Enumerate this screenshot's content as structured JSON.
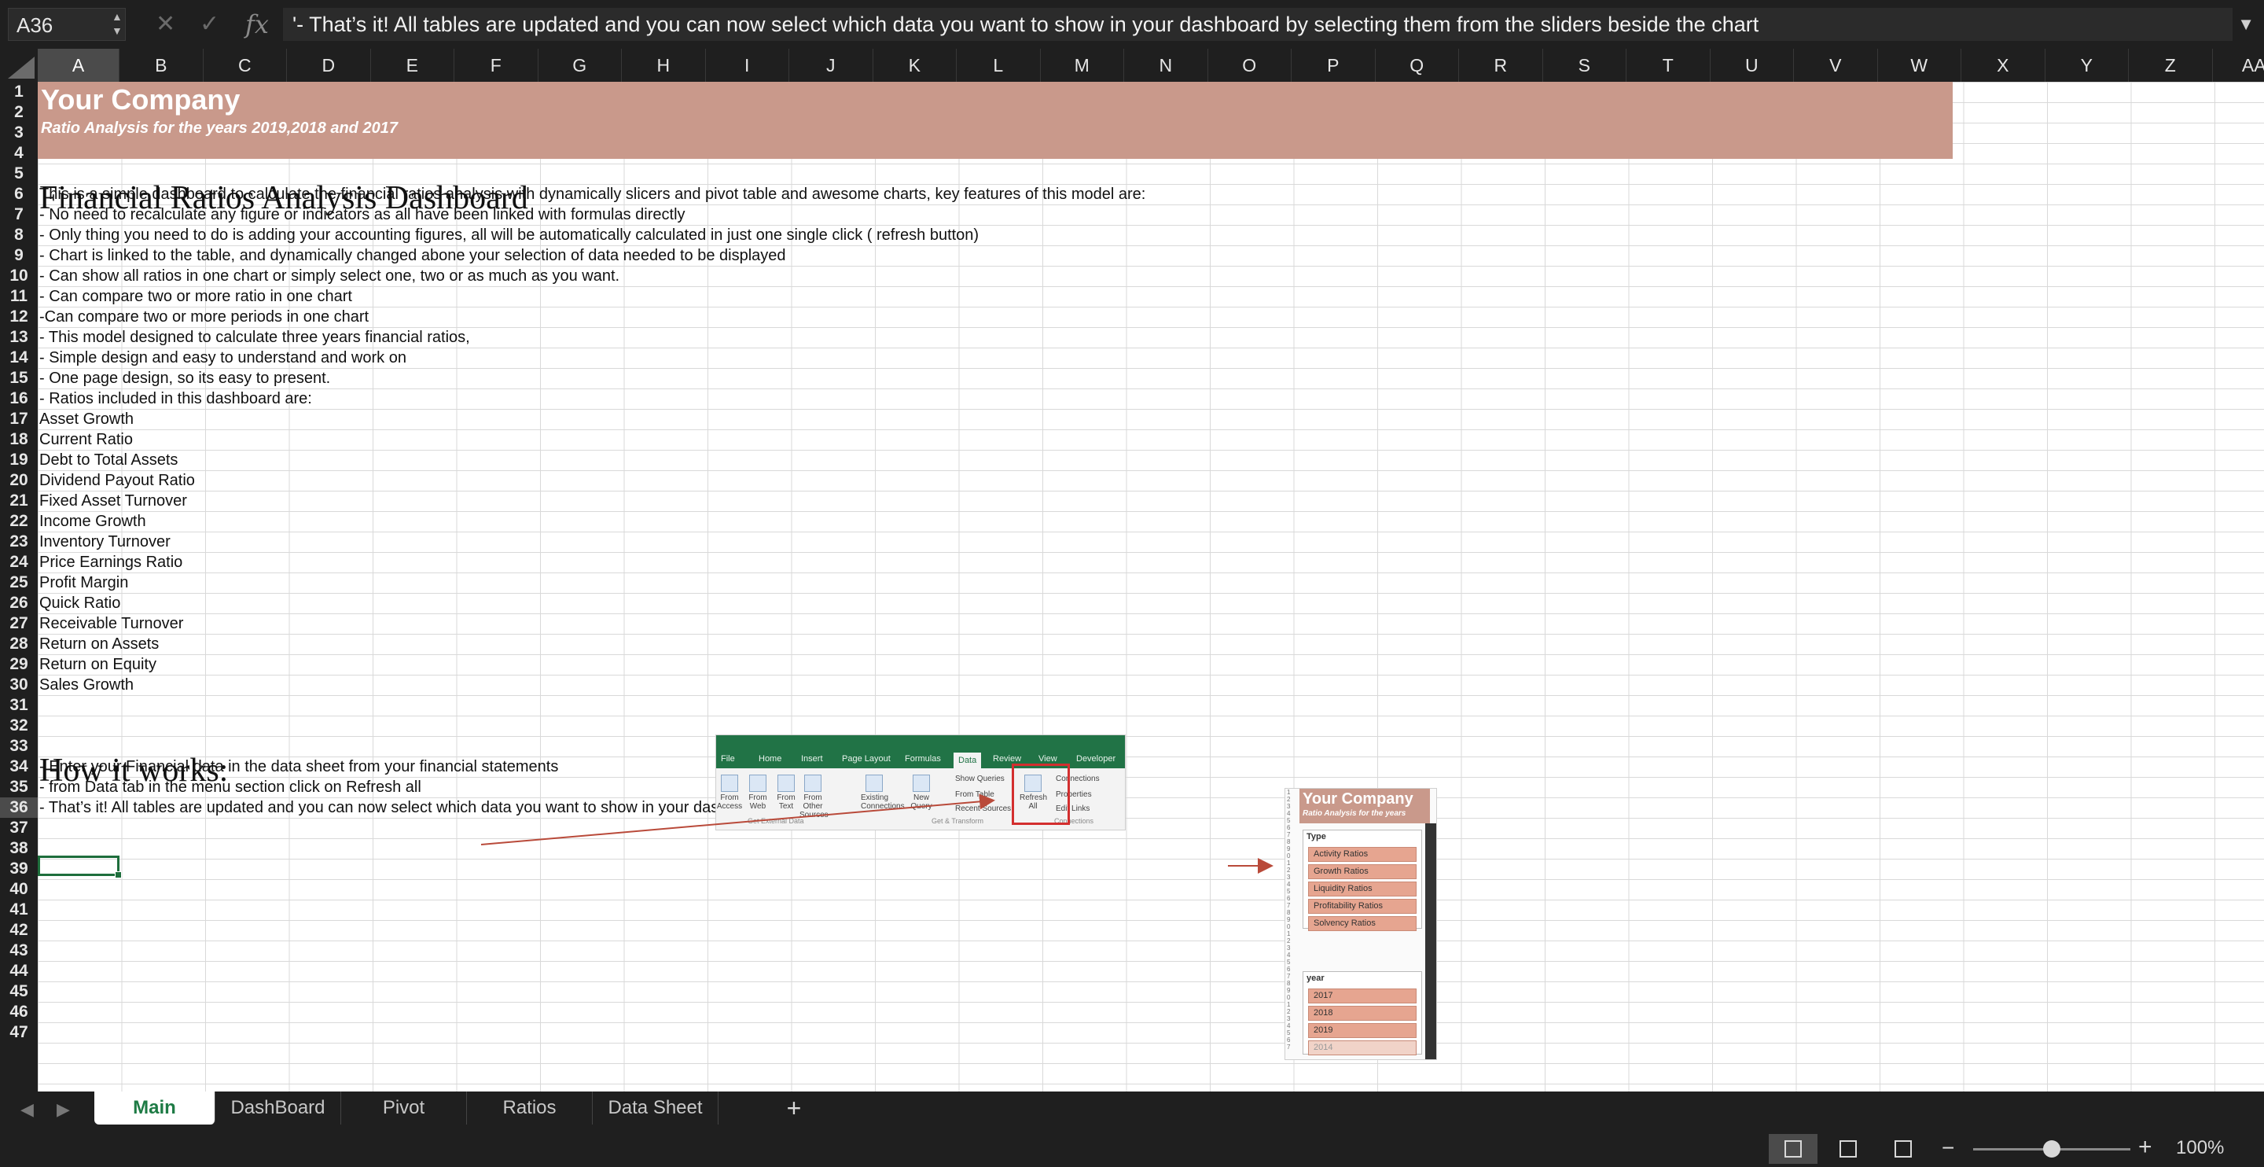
{
  "formula_bar": {
    "cell_ref": "A36",
    "fx": "fx",
    "cancel_symbol": "✕",
    "confirm_symbol": "✓",
    "content": "'- That’s it! All tables are updated and you can now select which data you want to show in your dashboard by selecting them from the sliders beside the chart"
  },
  "columns": [
    "A",
    "B",
    "C",
    "D",
    "E",
    "F",
    "G",
    "H",
    "I",
    "J",
    "K",
    "L",
    "M",
    "N",
    "O",
    "P",
    "Q",
    "R",
    "S",
    "T",
    "U",
    "V",
    "W",
    "X",
    "Y",
    "Z",
    "AA"
  ],
  "selected_column": "A",
  "rows": [
    "1",
    "2",
    "3",
    "4",
    "5",
    "6",
    "7",
    "8",
    "9",
    "10",
    "11",
    "12",
    "13",
    "14",
    "15",
    "16",
    "17",
    "18",
    "19",
    "20",
    "21",
    "22",
    "23",
    "24",
    "25",
    "26",
    "27",
    "28",
    "29",
    "30",
    "31",
    "32",
    "33",
    "34",
    "35",
    "36",
    "37",
    "38",
    "39",
    "40",
    "41",
    "42",
    "43",
    "44",
    "45",
    "46",
    "47"
  ],
  "selected_row": "36",
  "banner": {
    "title": "Your Company",
    "subtitle": "Ratio Analysis for the years 2019,2018 and 2017",
    "color": "#c9998b"
  },
  "sheet": {
    "heading_dashboard": "Financial Ratios Analysis Dashboard",
    "intro_lines": [
      "This is a simple dashboard to calculate the financial ratios analysis with dynamically slicers and pivot table and awesome charts, key features of this model are:",
      "- No need to recalculate any figure or indicators as all have been linked with formulas directly",
      "- Only thing you need to do is adding your accounting figures, all will be automatically calculated in just one single click ( refresh button)",
      "- Chart is linked to the table, and dynamically changed abone your selection of data needed to be displayed",
      "- Can show all ratios in one chart or simply select one, two or as much as you want.",
      "- Can compare two or more ratio in one chart",
      " -Can compare two or more periods in one chart",
      "- This model designed to calculate three years financial ratios,",
      "- Simple design and easy to understand and work on",
      "- One page design, so its easy to present.",
      "- Ratios included in this dashboard are:"
    ],
    "ratios": [
      "Asset Growth",
      "Current Ratio",
      "Debt to Total Assets",
      "Dividend Payout Ratio",
      "Fixed Asset Turnover",
      "Income Growth",
      "Inventory Turnover",
      "Price Earnings Ratio",
      "Profit Margin",
      "Quick Ratio",
      "Receivable Turnover",
      "Return on Assets",
      "Return on Equity",
      "Sales Growth"
    ],
    "heading_how": "How it works:",
    "how_lines": [
      "- Enter your Financial data in the data sheet from your financial statements",
      "- from Data tab in the menu section click on Refresh all",
      "- That’s it! All tables are updated and you can now select which data you want to show in your dashboard by selecting them from the sliders beside the chart"
    ]
  },
  "ribbon_image": {
    "tabs": [
      "File",
      "Home",
      "Insert",
      "Page Layout",
      "Formulas",
      "Data",
      "Review",
      "View",
      "Developer"
    ],
    "active_tab": "Data",
    "buttons": [
      "From Access",
      "From Web",
      "From Text",
      "From Other Sources",
      "Existing Connections",
      "New Query",
      "Refresh All"
    ],
    "small_items": [
      "Show Queries",
      "From Table",
      "Recent Sources",
      "Connections",
      "Properties",
      "Edit Links"
    ],
    "groups": [
      "Get External Data",
      "Get & Transform",
      "Connections"
    ]
  },
  "slicer_image": {
    "company": "Your Company",
    "subtitle": "Ratio Analysis for the years",
    "type_title": "Type",
    "types": [
      "Activity Ratios",
      "Growth Ratios",
      "Liquidity Ratios",
      "Profitability Ratios",
      "Solvency Ratios"
    ],
    "year_title": "year",
    "years": [
      "2017",
      "2018",
      "2019",
      "2014"
    ]
  },
  "sheet_tabs": [
    "Main",
    "DashBoard",
    "Pivot",
    "Ratios",
    "Data Sheet"
  ],
  "active_sheet": "Main",
  "add_sheet": "+",
  "status": {
    "zoom_label": "100%",
    "zoom_value": 100,
    "zoom_minus": "−",
    "zoom_plus": "+"
  },
  "colors": {
    "accent_green": "#1e7b45",
    "arrow_red": "#b94a3a"
  }
}
